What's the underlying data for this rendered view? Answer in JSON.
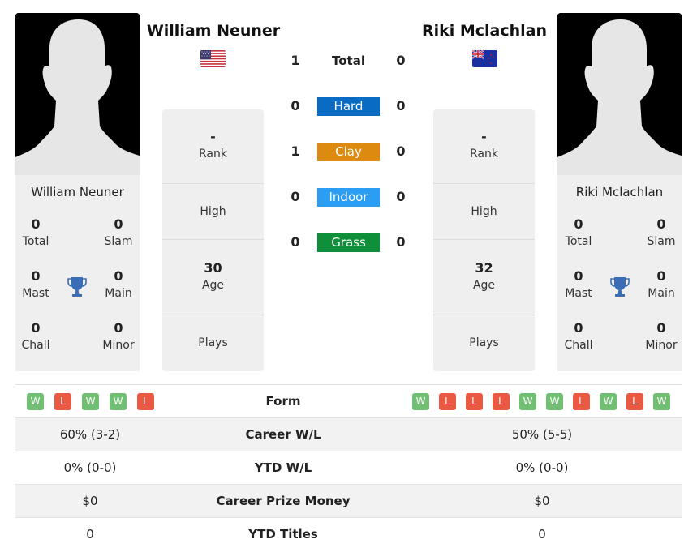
{
  "colors": {
    "hard": "#0a6bc4",
    "clay": "#dd8a10",
    "indoor": "#2b9ef4",
    "grass": "#108f3a",
    "win": "#71bf72",
    "loss": "#ea5a42",
    "trophy": "#3a6db5"
  },
  "player1": {
    "name": "William Neuner",
    "flag": "us-flag",
    "stats": {
      "total": {
        "value": "0",
        "label": "Total"
      },
      "slam": {
        "value": "0",
        "label": "Slam"
      },
      "mast": {
        "value": "0",
        "label": "Mast"
      },
      "main": {
        "value": "0",
        "label": "Main"
      },
      "chall": {
        "value": "0",
        "label": "Chall"
      },
      "minor": {
        "value": "0",
        "label": "Minor"
      }
    },
    "info": {
      "rank": {
        "value": "-",
        "label": "Rank"
      },
      "high": {
        "value": "",
        "label": "High"
      },
      "age": {
        "value": "30",
        "label": "Age"
      },
      "plays": {
        "value": "",
        "label": "Plays"
      }
    },
    "form": [
      "W",
      "L",
      "W",
      "W",
      "L"
    ],
    "career_wl": "60% (3-2)",
    "ytd_wl": "0% (0-0)",
    "prize_money": "$0",
    "ytd_titles": "0"
  },
  "player2": {
    "name": "Riki Mclachlan",
    "flag": "nz-flag",
    "stats": {
      "total": {
        "value": "0",
        "label": "Total"
      },
      "slam": {
        "value": "0",
        "label": "Slam"
      },
      "mast": {
        "value": "0",
        "label": "Mast"
      },
      "main": {
        "value": "0",
        "label": "Main"
      },
      "chall": {
        "value": "0",
        "label": "Chall"
      },
      "minor": {
        "value": "0",
        "label": "Minor"
      }
    },
    "info": {
      "rank": {
        "value": "-",
        "label": "Rank"
      },
      "high": {
        "value": "",
        "label": "High"
      },
      "age": {
        "value": "32",
        "label": "Age"
      },
      "plays": {
        "value": "",
        "label": "Plays"
      }
    },
    "form": [
      "W",
      "L",
      "L",
      "L",
      "W",
      "W",
      "L",
      "W",
      "L",
      "W"
    ],
    "career_wl": "50% (5-5)",
    "ytd_wl": "0% (0-0)",
    "prize_money": "$0",
    "ytd_titles": "0"
  },
  "h2h": {
    "total": {
      "label": "Total",
      "p1": "1",
      "p2": "0"
    },
    "hard": {
      "label": "Hard",
      "p1": "0",
      "p2": "0"
    },
    "clay": {
      "label": "Clay",
      "p1": "1",
      "p2": "0"
    },
    "indoor": {
      "label": "Indoor",
      "p1": "0",
      "p2": "0"
    },
    "grass": {
      "label": "Grass",
      "p1": "0",
      "p2": "0"
    }
  },
  "comparison": {
    "form_label": "Form",
    "career_wl_label": "Career W/L",
    "ytd_wl_label": "YTD W/L",
    "prize_money_label": "Career Prize Money",
    "ytd_titles_label": "YTD Titles"
  }
}
